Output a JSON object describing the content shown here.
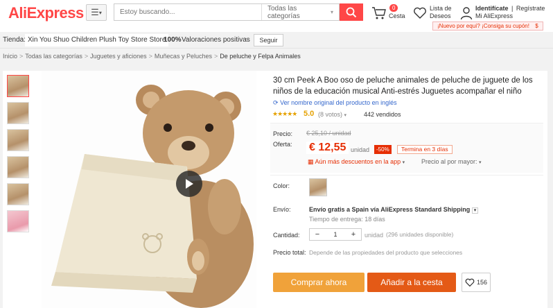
{
  "header": {
    "logo": "AliExpress",
    "search_placeholder": "Estoy buscando...",
    "search_category": "Todas las categorías",
    "cart_count": "0",
    "cart_label": "Cesta",
    "wishlist_label_1": "Lista de",
    "wishlist_label_2": "Deseos",
    "account_signin": "Identifícate",
    "account_sep": "|",
    "account_register": "Regístrate",
    "account_my": "Mi AliExpress",
    "promo": "¡Nuevo por equí? ¡Consiga su cupón!",
    "promo_icon": "$"
  },
  "store": {
    "label": "Tienda:",
    "name": "Xin You Shuo Children Plush Toy Store Store",
    "positive_pct": "100%",
    "positive_label": "Valoraciones positivas",
    "follow": "Seguir"
  },
  "breadcrumb": [
    "Inicio",
    "Todas las categorías",
    "Juguetes y aficiones",
    "Muñecas y Peluches",
    "De peluche y Felpa Animales"
  ],
  "product": {
    "title": "30 cm Peek A Boo oso de peluche animales de peluche de juguete de los niños de la educación musical Anti-estrés Juguetes acompañar el niño",
    "original_name": "Ver nombre original del producto en inglés",
    "rating": "5.0",
    "votes": "(8 votos)",
    "sold": "442 vendidos",
    "price_label": "Precio:",
    "old_price": "€ 25,10 / unidad",
    "offer_label": "Oferta:",
    "new_price": "€ 12,55",
    "unit": "unidad",
    "discount": "-50%",
    "countdown": "Termina en 3 días",
    "more_discounts": "Aún más descuentos en la app",
    "bulk_price": "Precio al por mayor:",
    "color_label": "Color:",
    "shipping_label": "Envío:",
    "shipping_title": "Envío gratis a Spain vía AliExpress Standard Shipping",
    "shipping_time": "Tiempo de entrega: 18 días",
    "qty_label": "Cantidad:",
    "qty_minus": "−",
    "qty_value": "1",
    "qty_plus": "+",
    "qty_unit": "unidad",
    "stock": "(296 unidades disponible)",
    "total_label": "Precio total:",
    "total_note": "Depende de las propiedades del producto que selecciones",
    "buy_now": "Comprar ahora",
    "add_to_cart": "Añadir a la cesta",
    "wishlist_count": "156"
  },
  "colors": {
    "brand": "#ff4747",
    "price": "#e62e04",
    "buy": "#f0a23a",
    "cart": "#e45a16",
    "star": "#e5a100"
  }
}
